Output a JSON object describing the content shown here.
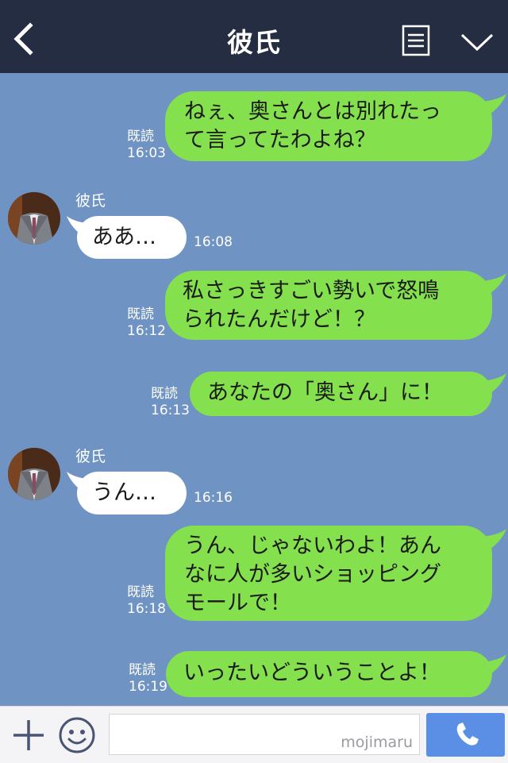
{
  "header": {
    "title": "彼氏"
  },
  "messages": [
    {
      "from": "me",
      "text": "ねぇ、奥さんとは別れたっ\nて言ってたわよね？",
      "read": "既読",
      "time": "16:03"
    },
    {
      "from": "them",
      "sender": "彼氏",
      "text": "ああ…",
      "time": "16:08"
    },
    {
      "from": "me",
      "text": "私さっきすごい勢いで怒鳴\nられたんだけど！？",
      "read": "既読",
      "time": "16:12"
    },
    {
      "from": "me",
      "text": "あなたの「奥さん」に！",
      "read": "既読",
      "time": "16:13"
    },
    {
      "from": "them",
      "sender": "彼氏",
      "text": "うん…",
      "time": "16:16"
    },
    {
      "from": "me",
      "text": "うん、じゃないわよ！あん\nなに人が多いショッピング\nモールで！",
      "read": "既読",
      "time": "16:18"
    },
    {
      "from": "me",
      "text": "いったいどういうことよ！",
      "read": "既読",
      "time": "16:19"
    }
  ],
  "footer": {
    "input_value": "",
    "watermark": "mojimaru"
  },
  "colors": {
    "header_bg": "#242d42",
    "chat_bg": "#6f93c3",
    "my_bubble": "#84e04c",
    "their_bubble": "#ffffff",
    "call_button": "#5b8ee5"
  },
  "icons": [
    "back-arrow-icon",
    "menu-icon",
    "chevron-down-icon",
    "plus-icon",
    "emoji-icon",
    "phone-icon"
  ]
}
